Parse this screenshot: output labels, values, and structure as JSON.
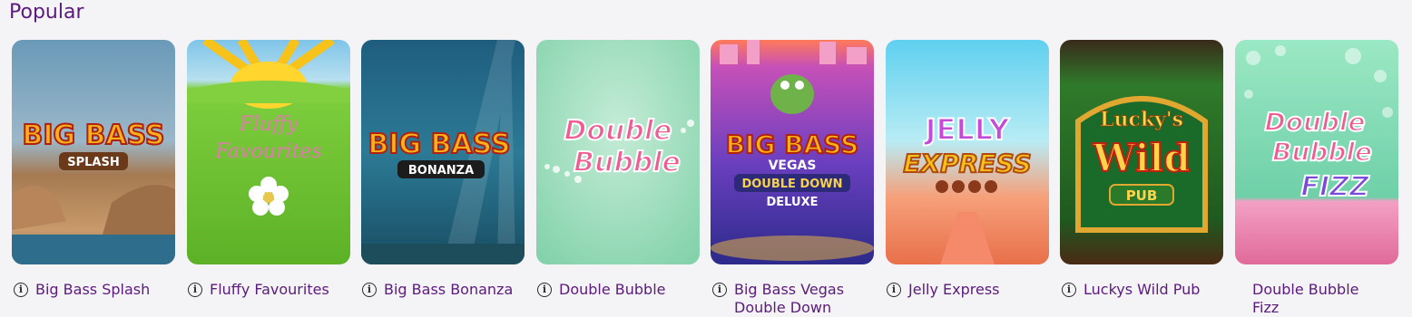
{
  "section": {
    "title": "Popular"
  },
  "info_glyph": "i",
  "games": [
    {
      "name": "Big Bass Splash",
      "art_title": "BIG BASS",
      "art_sub": "SPLASH",
      "has_info": true
    },
    {
      "name": "Fluffy Favourites",
      "art_title": "Fluffy",
      "art_sub": "Favourites",
      "has_info": true
    },
    {
      "name": "Big Bass Bonanza",
      "art_title": "BIG BASS",
      "art_sub": "BONANZA",
      "has_info": true
    },
    {
      "name": "Double Bubble",
      "art_title": "Double",
      "art_sub": "Bubble",
      "has_info": true
    },
    {
      "name": "Big Bass Vegas Double Down",
      "art_title": "BIG BASS",
      "art_sub": "VEGAS",
      "art_sub2": "DOUBLE DOWN",
      "art_sub3": "DELUXE",
      "has_info": true
    },
    {
      "name": "Jelly Express",
      "art_title": "JELLY",
      "art_sub": "EXPRESS",
      "has_info": true
    },
    {
      "name": "Luckys Wild Pub",
      "art_title": "Lucky's",
      "art_sub": "Wild",
      "art_sub2": "PUB",
      "has_info": true
    },
    {
      "name": "Double Bubble Fizz",
      "art_title": "Double",
      "art_sub": "Bubble",
      "art_sub2": "FIZZ",
      "has_info": false
    }
  ]
}
